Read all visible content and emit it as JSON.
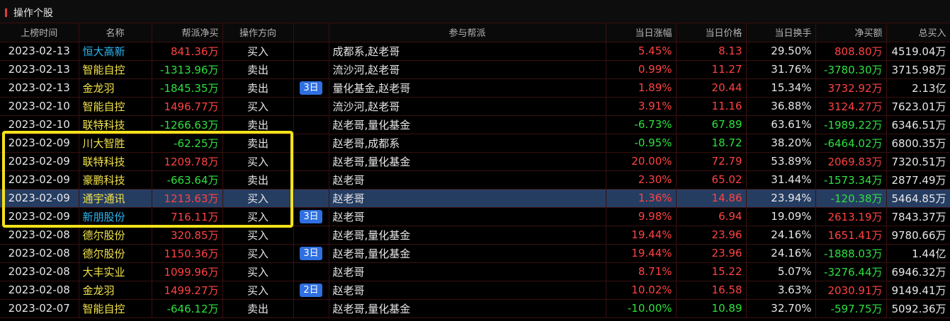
{
  "panel": {
    "title": "操作个股"
  },
  "columns": [
    "上榜时间",
    "名称",
    "帮派净买",
    "操作方向",
    "",
    "参与帮派",
    "当日涨幅",
    "当日价格",
    "当日换手",
    "净买额",
    "总买入"
  ],
  "colors": {
    "up": "#ff4242",
    "down": "#2fe03f",
    "name_default": "#f2e24a",
    "name_link": "#2cb6f2",
    "badge": "#2f6fe0",
    "highlight_box": "#f4e21a",
    "selected_row": "#263d62"
  },
  "rows": [
    {
      "date": "2023-02-13",
      "name": "恒大高新",
      "name_color": "cyan",
      "gang_net": "841.36万",
      "gang_color": "red",
      "direction": "买入",
      "badge": "",
      "gangs": "成都系,赵老哥",
      "change": "5.45%",
      "change_color": "red",
      "price": "8.13",
      "price_color": "red",
      "turnover": "29.50%",
      "net_buy": "808.80万",
      "net_color": "red",
      "total_buy": "4519.04万",
      "selected": false
    },
    {
      "date": "2023-02-13",
      "name": "智能自控",
      "name_color": "yellow",
      "gang_net": "-1313.96万",
      "gang_color": "green",
      "direction": "卖出",
      "badge": "",
      "gangs": "流沙河,赵老哥",
      "change": "0.99%",
      "change_color": "red",
      "price": "11.27",
      "price_color": "red",
      "turnover": "31.76%",
      "net_buy": "-3780.30万",
      "net_color": "green",
      "total_buy": "3715.98万",
      "selected": false
    },
    {
      "date": "2023-02-13",
      "name": "金龙羽",
      "name_color": "yellow",
      "gang_net": "-1845.35万",
      "gang_color": "green",
      "direction": "卖出",
      "badge": "3日",
      "gangs": "量化基金,赵老哥",
      "change": "1.89%",
      "change_color": "red",
      "price": "20.44",
      "price_color": "red",
      "turnover": "15.34%",
      "net_buy": "3732.92万",
      "net_color": "red",
      "total_buy": "2.13亿",
      "selected": false
    },
    {
      "date": "2023-02-10",
      "name": "智能自控",
      "name_color": "yellow",
      "gang_net": "1496.77万",
      "gang_color": "red",
      "direction": "买入",
      "badge": "",
      "gangs": "流沙河,赵老哥",
      "change": "3.91%",
      "change_color": "red",
      "price": "11.16",
      "price_color": "red",
      "turnover": "36.88%",
      "net_buy": "3124.27万",
      "net_color": "red",
      "total_buy": "7623.01万",
      "selected": false
    },
    {
      "date": "2023-02-10",
      "name": "联特科技",
      "name_color": "yellow",
      "gang_net": "-1266.63万",
      "gang_color": "green",
      "direction": "卖出",
      "badge": "",
      "gangs": "赵老哥,量化基金",
      "change": "-6.73%",
      "change_color": "green",
      "price": "67.89",
      "price_color": "green",
      "turnover": "63.61%",
      "net_buy": "-1989.22万",
      "net_color": "green",
      "total_buy": "6346.51万",
      "selected": false
    },
    {
      "date": "2023-02-09",
      "name": "川大智胜",
      "name_color": "yellow",
      "gang_net": "-62.25万",
      "gang_color": "green",
      "direction": "卖出",
      "badge": "",
      "gangs": "赵老哥,成都系",
      "change": "-0.95%",
      "change_color": "green",
      "price": "18.72",
      "price_color": "green",
      "turnover": "38.20%",
      "net_buy": "-6464.02万",
      "net_color": "green",
      "total_buy": "6800.35万",
      "selected": false
    },
    {
      "date": "2023-02-09",
      "name": "联特科技",
      "name_color": "yellow",
      "gang_net": "1209.78万",
      "gang_color": "red",
      "direction": "买入",
      "badge": "",
      "gangs": "赵老哥,量化基金",
      "change": "20.00%",
      "change_color": "red",
      "price": "72.79",
      "price_color": "red",
      "turnover": "53.89%",
      "net_buy": "2069.83万",
      "net_color": "red",
      "total_buy": "7320.51万",
      "selected": false
    },
    {
      "date": "2023-02-09",
      "name": "豪鹏科技",
      "name_color": "yellow",
      "gang_net": "-663.64万",
      "gang_color": "green",
      "direction": "卖出",
      "badge": "",
      "gangs": "赵老哥",
      "change": "2.30%",
      "change_color": "red",
      "price": "65.02",
      "price_color": "red",
      "turnover": "31.44%",
      "net_buy": "-1573.34万",
      "net_color": "green",
      "total_buy": "2877.49万",
      "selected": false
    },
    {
      "date": "2023-02-09",
      "name": "通宇通讯",
      "name_color": "yellow",
      "gang_net": "1213.63万",
      "gang_color": "red",
      "direction": "买入",
      "badge": "",
      "gangs": "赵老哥",
      "change": "1.36%",
      "change_color": "red",
      "price": "14.86",
      "price_color": "red",
      "turnover": "23.94%",
      "net_buy": "-120.38万",
      "net_color": "green",
      "total_buy": "5464.85万",
      "selected": true
    },
    {
      "date": "2023-02-09",
      "name": "新朋股份",
      "name_color": "cyan",
      "gang_net": "716.11万",
      "gang_color": "red",
      "direction": "买入",
      "badge": "3日",
      "gangs": "赵老哥",
      "change": "9.98%",
      "change_color": "red",
      "price": "6.94",
      "price_color": "red",
      "turnover": "19.09%",
      "net_buy": "2613.19万",
      "net_color": "red",
      "total_buy": "7843.37万",
      "selected": false
    },
    {
      "date": "2023-02-08",
      "name": "德尔股份",
      "name_color": "yellow",
      "gang_net": "320.85万",
      "gang_color": "red",
      "direction": "买入",
      "badge": "",
      "gangs": "赵老哥,量化基金",
      "change": "19.44%",
      "change_color": "red",
      "price": "23.96",
      "price_color": "red",
      "turnover": "24.16%",
      "net_buy": "1651.41万",
      "net_color": "red",
      "total_buy": "9780.66万",
      "selected": false
    },
    {
      "date": "2023-02-08",
      "name": "德尔股份",
      "name_color": "yellow",
      "gang_net": "1150.36万",
      "gang_color": "red",
      "direction": "买入",
      "badge": "3日",
      "gangs": "赵老哥,量化基金",
      "change": "19.44%",
      "change_color": "red",
      "price": "23.96",
      "price_color": "red",
      "turnover": "24.16%",
      "net_buy": "-1888.03万",
      "net_color": "green",
      "total_buy": "1.44亿",
      "selected": false
    },
    {
      "date": "2023-02-08",
      "name": "大丰实业",
      "name_color": "yellow",
      "gang_net": "1099.96万",
      "gang_color": "red",
      "direction": "买入",
      "badge": "",
      "gangs": "赵老哥",
      "change": "8.71%",
      "change_color": "red",
      "price": "15.22",
      "price_color": "red",
      "turnover": "5.07%",
      "net_buy": "-3276.44万",
      "net_color": "green",
      "total_buy": "6946.32万",
      "selected": false
    },
    {
      "date": "2023-02-08",
      "name": "金龙羽",
      "name_color": "yellow",
      "gang_net": "1499.27万",
      "gang_color": "red",
      "direction": "买入",
      "badge": "2日",
      "gangs": "赵老哥",
      "change": "10.02%",
      "change_color": "red",
      "price": "16.58",
      "price_color": "red",
      "turnover": "3.63%",
      "net_buy": "2030.91万",
      "net_color": "red",
      "total_buy": "9149.41万",
      "selected": false
    },
    {
      "date": "2023-02-07",
      "name": "智能自控",
      "name_color": "yellow",
      "gang_net": "-646.12万",
      "gang_color": "green",
      "direction": "卖出",
      "badge": "",
      "gangs": "赵老哥,量化基金",
      "change": "-10.00%",
      "change_color": "green",
      "price": "10.89",
      "price_color": "green",
      "turnover": "32.70%",
      "net_buy": "-597.75万",
      "net_color": "green",
      "total_buy": "5092.36万",
      "selected": false
    }
  ]
}
